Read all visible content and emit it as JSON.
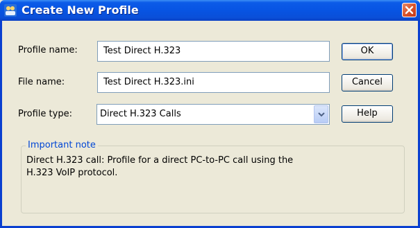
{
  "window": {
    "title": "Create New Profile"
  },
  "form": {
    "profile_name_label": "Profile name:",
    "profile_name_value": "Test Direct H.323",
    "file_name_label": "File name:",
    "file_name_value": "Test Direct H.323.ini",
    "profile_type_label": "Profile type:",
    "profile_type_value": "Direct H.323 Calls"
  },
  "buttons": {
    "ok": "OK",
    "cancel": "Cancel",
    "help": "Help"
  },
  "note": {
    "title": "Important note",
    "line1": "Direct H.323 call: Profile for a direct PC-to-PC call using the",
    "line2": "H.323 VoIP protocol."
  },
  "icons": {
    "app": "profile-app-icon",
    "close": "close-icon",
    "dropdown": "chevron-down-icon"
  },
  "colors": {
    "title_bar": "#0754e3",
    "close_button": "#d9542a",
    "group_title": "#0046d5",
    "dialog_bg": "#ece9d8"
  }
}
